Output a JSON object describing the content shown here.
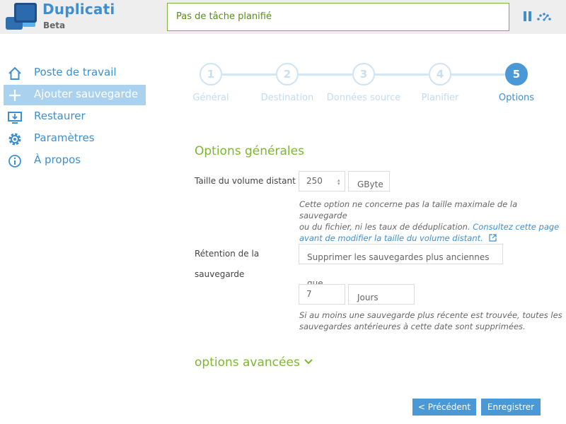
{
  "app": {
    "title": "Duplicati",
    "subtitle": "Beta"
  },
  "header": {
    "status_text": "Pas de tâche planifié",
    "icons": [
      "pause-icon",
      "throttle-icon"
    ]
  },
  "sidebar": {
    "items": [
      {
        "label": "Poste de travail",
        "icon": "home-icon",
        "active": false
      },
      {
        "label": "Ajouter sauvegarde",
        "icon": "plus-icon",
        "active": true
      },
      {
        "label": "Restaurer",
        "icon": "restore-icon",
        "active": false
      },
      {
        "label": "Paramètres",
        "icon": "gear-icon",
        "active": false
      },
      {
        "label": "À propos",
        "icon": "info-icon",
        "active": false
      }
    ]
  },
  "wizard": {
    "current_step": 5,
    "steps": [
      {
        "number": "1",
        "label": "Général"
      },
      {
        "number": "2",
        "label": "Destination"
      },
      {
        "number": "3",
        "label": "Données source"
      },
      {
        "number": "4",
        "label": "Planifier"
      },
      {
        "number": "5",
        "label": "Options"
      }
    ]
  },
  "general_options": {
    "title": "Options générales",
    "volume_size": {
      "label": "Taille du volume distant",
      "value": "250",
      "unit": "GByte",
      "help_line1": "Cette option ne concerne pas la taille maximale de la sauvegarde",
      "help_line2_text": "ou du fichier, ni les taux de déduplication. ",
      "help_line2_link": "Consultez cette page",
      "help_line3_link": "avant de modifier la taille du volume distant."
    },
    "retention": {
      "label_line1": "Rétention de la",
      "label_line2": "sauvegarde",
      "mode": "Supprimer les sauvegardes plus anciennes que",
      "value": "7",
      "unit": "Jours",
      "help_line1": "Si au moins une sauvegarde plus récente est trouvée, toutes les",
      "help_line2": "sauvegardes antérieures à cette date sont supprimées."
    }
  },
  "advanced": {
    "label": "options avancées"
  },
  "actions": {
    "previous_label": "< Précédent",
    "save_label": "Enregistrer"
  },
  "colors": {
    "accent_blue": "#3d8fd0",
    "accent_green": "#7cb82f",
    "active_nav_bg": "#aad2ee"
  }
}
